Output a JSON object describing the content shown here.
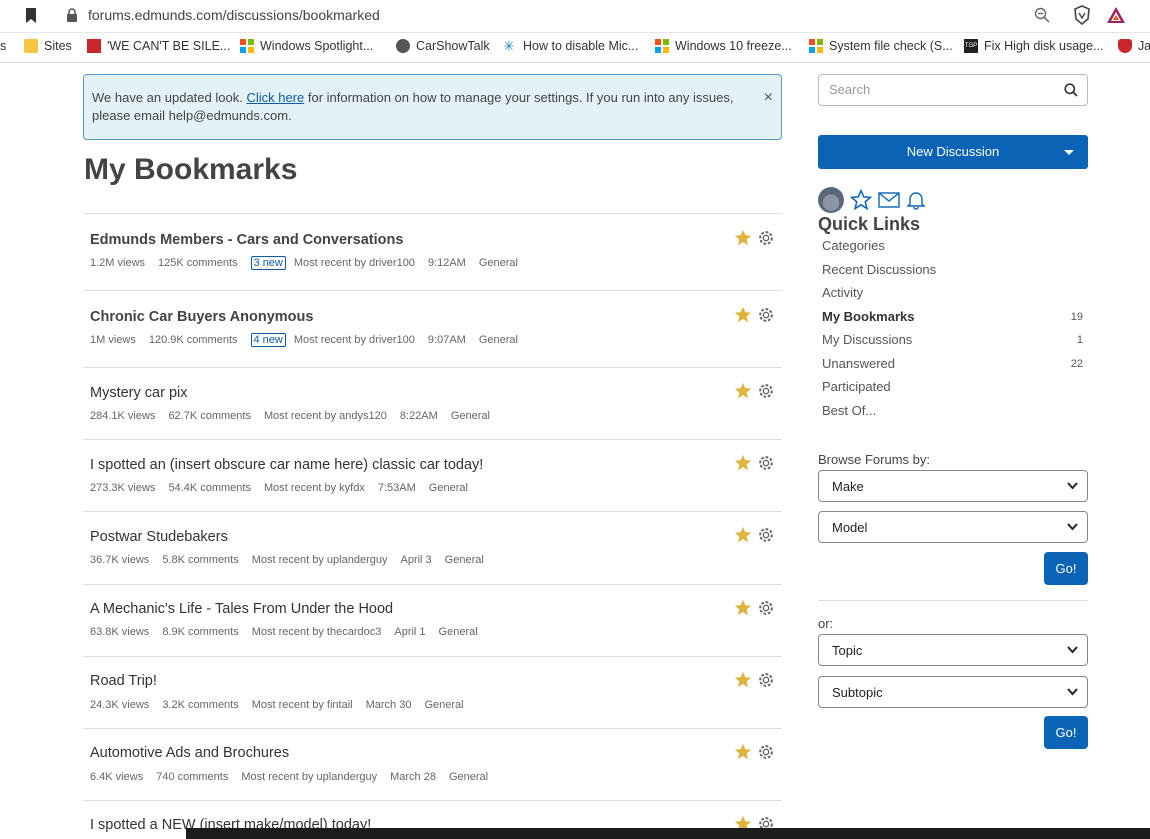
{
  "browser": {
    "url": "forums.edmunds.com/discussions/bookmarked",
    "bookmarks": [
      {
        "label": "s",
        "icon": "cut-off"
      },
      {
        "label": "Sites",
        "icon": "folder-icon"
      },
      {
        "label": "'WE CAN'T BE SILE...",
        "icon": "red-flag-icon"
      },
      {
        "label": "Windows Spotlight...",
        "icon": "microsoft-icon"
      },
      {
        "label": "CarShowTalk",
        "icon": "globe-icon"
      },
      {
        "label": "How to disable Mic...",
        "icon": "sparkle-icon"
      },
      {
        "label": "Windows 10 freeze...",
        "icon": "microsoft-icon"
      },
      {
        "label": "System file check (S...",
        "icon": "microsoft-icon"
      },
      {
        "label": "Fix High disk usage...",
        "icon": "tgp-icon"
      },
      {
        "label": "Ja",
        "icon": "shield-icon"
      }
    ]
  },
  "notice": {
    "text_before": "We have an updated look. ",
    "link": "Click here",
    "text_after": " for information on how to manage your settings. If you run into any issues, please email help@edmunds.com.",
    "close": "×"
  },
  "page_title": "My Bookmarks",
  "discussions": [
    {
      "title": "Edmunds Members - Cars and Conversations",
      "bold": true,
      "views": "1.2M views",
      "comments": "125K comments",
      "new": "3 new",
      "recent": "Most recent by driver100",
      "time": "9:12AM",
      "category": "General"
    },
    {
      "title": "Chronic Car Buyers Anonymous",
      "bold": true,
      "views": "1M views",
      "comments": "120.9K comments",
      "new": "4 new",
      "recent": "Most recent by driver100",
      "time": "9:07AM",
      "category": "General"
    },
    {
      "title": "Mystery car pix",
      "bold": false,
      "views": "284.1K views",
      "comments": "62.7K comments",
      "new": "",
      "recent": "Most recent by andys120",
      "time": "8:22AM",
      "category": "General"
    },
    {
      "title": "I spotted an (insert obscure car name here) classic car today!",
      "bold": false,
      "views": "273.3K views",
      "comments": "54.4K comments",
      "new": "",
      "recent": "Most recent by kyfdx",
      "time": "7:53AM",
      "category": "General"
    },
    {
      "title": "Postwar Studebakers",
      "bold": false,
      "views": "36.7K views",
      "comments": "5.8K comments",
      "new": "",
      "recent": "Most recent by uplanderguy",
      "time": "April 3",
      "category": "General"
    },
    {
      "title": "A Mechanic's Life - Tales From Under the Hood",
      "bold": false,
      "views": "63.8K views",
      "comments": "8.9K comments",
      "new": "",
      "recent": "Most recent by thecardoc3",
      "time": "April 1",
      "category": "General"
    },
    {
      "title": "Road Trip!",
      "bold": false,
      "views": "24.3K views",
      "comments": "3.2K comments",
      "new": "",
      "recent": "Most recent by fintail",
      "time": "March 30",
      "category": "General"
    },
    {
      "title": "Automotive Ads and Brochures",
      "bold": false,
      "views": "6.4K views",
      "comments": "740 comments",
      "new": "",
      "recent": "Most recent by uplanderguy",
      "time": "March 28",
      "category": "General"
    },
    {
      "title": "I spotted a NEW (insert make/model) today!",
      "bold": false,
      "views": "",
      "comments": "",
      "new": "",
      "recent": "",
      "time": "",
      "category": ""
    }
  ],
  "sidebar": {
    "search_placeholder": "Search",
    "new_discussion": "New Discussion",
    "quick_links_title": "Quick Links",
    "quick_links": [
      {
        "label": "Categories",
        "count": ""
      },
      {
        "label": "Recent Discussions",
        "count": ""
      },
      {
        "label": "Activity",
        "count": ""
      },
      {
        "label": "My Bookmarks",
        "count": "19",
        "active": true
      },
      {
        "label": "My Discussions",
        "count": "1"
      },
      {
        "label": "Unanswered",
        "count": "22"
      },
      {
        "label": "Participated",
        "count": ""
      },
      {
        "label": "Best Of...",
        "count": ""
      }
    ],
    "browse_label": "Browse Forums by:",
    "make": "Make",
    "model": "Model",
    "go": "Go!",
    "or_label": "or:",
    "topic": "Topic",
    "subtopic": "Subtopic"
  },
  "colors": {
    "accent": "#0b63b6",
    "star": "#e3b23c",
    "notice_bg": "#e3f1f8"
  }
}
